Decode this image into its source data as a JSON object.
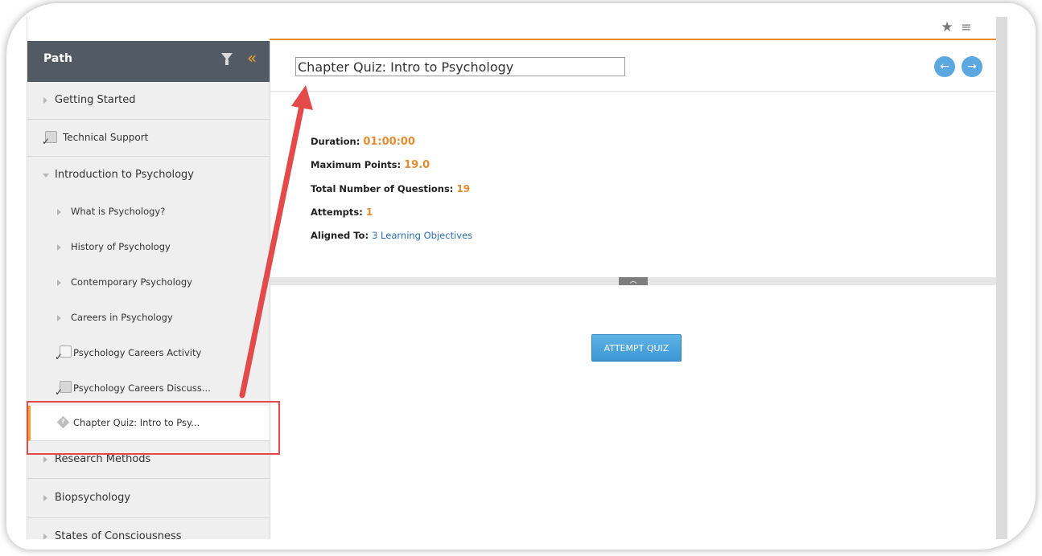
{
  "sidebar": {
    "title": "Path",
    "items": [
      {
        "label": "Getting Started"
      },
      {
        "label": "Technical Support"
      },
      {
        "label": "Introduction to Psychology"
      },
      {
        "label": "What is Psychology?"
      },
      {
        "label": "History of Psychology"
      },
      {
        "label": "Contemporary Psychology"
      },
      {
        "label": "Careers in Psychology"
      },
      {
        "label": "Psychology Careers Activity"
      },
      {
        "label": "Psychology Careers Discuss..."
      },
      {
        "label": "Chapter Quiz: Intro to Psy..."
      },
      {
        "label": "Research Methods"
      },
      {
        "label": "Biopsychology"
      },
      {
        "label": "States of Consciousness"
      }
    ]
  },
  "content": {
    "title": "Chapter Quiz: Intro to Psychology",
    "duration_label": "Duration:",
    "duration_value": "01:00:00",
    "max_points_label": "Maximum Points:",
    "max_points_value": "19.0",
    "questions_label": "Total Number of Questions:",
    "questions_value": "19",
    "attempts_label": "Attempts:",
    "attempts_value": "1",
    "aligned_label": "Aligned To:",
    "aligned_value": "3 Learning Objectives",
    "attempt_button": "ATTEMPT QUIZ"
  },
  "icons": {
    "star": "star-icon",
    "menu": "menu-icon",
    "filter": "filter-icon",
    "collapse": "double-chevron-left-icon",
    "prev": "arrow-left-icon",
    "next": "arrow-right-icon"
  },
  "colors": {
    "accent": "#e88a2e",
    "sidebar_header": "#525a64",
    "button": "#3c97d3",
    "highlight": "#e34b4b"
  }
}
